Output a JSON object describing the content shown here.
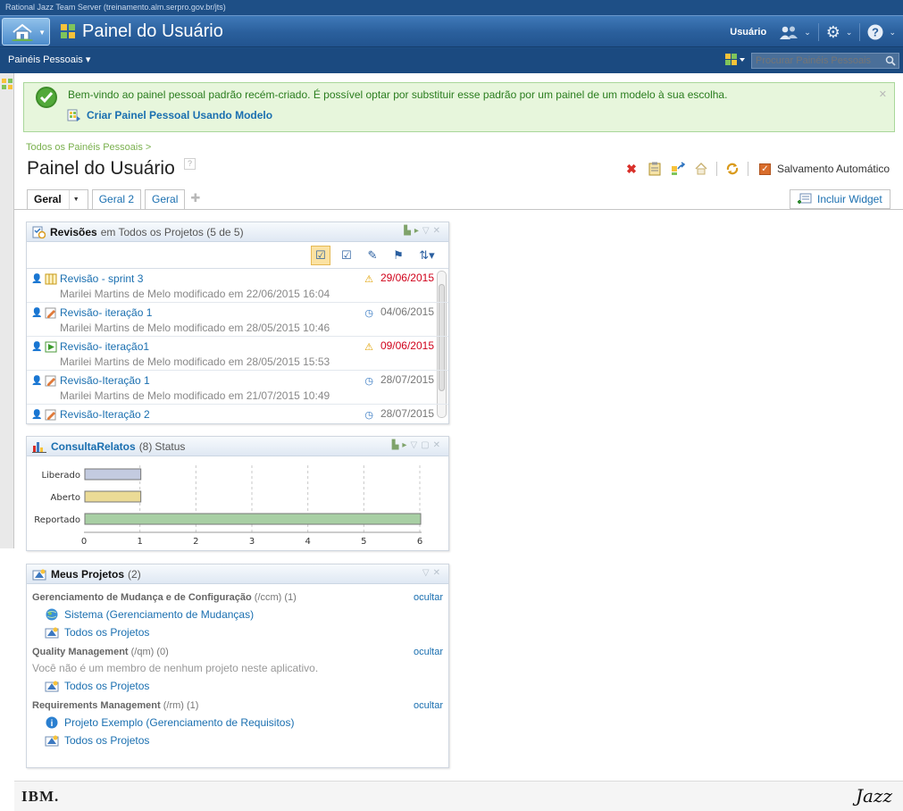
{
  "top": {
    "url": "Rational Jazz Team Server (treinamento.alm.serpro.gov.br/jts)",
    "title": "Painel do Usuário",
    "user_label": "Usuário"
  },
  "subbar": {
    "menu_label": "Painéis Pessoais ▾",
    "search_placeholder": "Procurar Painéis Pessoais"
  },
  "welcome": {
    "message": "Bem-vindo ao painel pessoal padrão recém-criado. É possível optar por substituir esse padrão por um painel de um modelo à sua escolha.",
    "link": "Criar Painel Pessoal Usando Modelo"
  },
  "breadcrumb": "Todos os Painéis Pessoais >",
  "page_title": "Painel do Usuário",
  "help_icon": "?",
  "toolbar": {
    "autosave_label": "Salvamento Automático"
  },
  "tabs": [
    {
      "label": "Geral"
    },
    {
      "label": "Geral 2"
    },
    {
      "label": "Geral"
    }
  ],
  "add_widget_label": "Incluir Widget",
  "reviews": {
    "title": "Revisões",
    "subtitle": "em Todos os Projetos (5 de 5)",
    "items": [
      {
        "name": "Revisão - sprint 3",
        "meta": "Marilei Martins de Melo modificado em 22/06/2015 16:04",
        "date": "29/06/2015",
        "late": true,
        "type": "review-icon"
      },
      {
        "name": "Revisão- iteração 1",
        "meta": "Marilei Martins de Melo modificado em 28/05/2015 10:46",
        "date": "04/06/2015",
        "late": false,
        "type": "edit-icon"
      },
      {
        "name": "Revisão- iteração1",
        "meta": "Marilei Martins de Melo modificado em 28/05/2015 15:53",
        "date": "09/06/2015",
        "late": true,
        "type": "play-icon"
      },
      {
        "name": "Revisão-Iteração 1",
        "meta": "Marilei Martins de Melo modificado em 21/07/2015 10:49",
        "date": "28/07/2015",
        "late": false,
        "type": "edit-icon"
      },
      {
        "name": "Revisão-Iteração 2",
        "meta": "",
        "date": "28/07/2015",
        "late": false,
        "type": "edit-icon"
      }
    ]
  },
  "consulta": {
    "title": "ConsultaRelatos",
    "count": "(8)",
    "subtitle": "Status"
  },
  "chart_data": {
    "type": "bar",
    "orientation": "horizontal",
    "categories": [
      "Liberado",
      "Aberto",
      "Reportado"
    ],
    "values": [
      1,
      1,
      6
    ],
    "colors": [
      "#c3cbe0",
      "#ebdb96",
      "#a8cfa4"
    ],
    "xlim": [
      0,
      6
    ],
    "xticks": [
      "0",
      "1",
      "2",
      "3",
      "4",
      "5",
      "6"
    ],
    "grid": true
  },
  "projects": {
    "title": "Meus Projetos",
    "count": "(2)",
    "hide_label": "ocultar",
    "sections": [
      {
        "name": "Gerenciamento de Mudança e de Configuração",
        "path": "(/ccm)",
        "count": "(1)",
        "links": [
          {
            "label": "Sistema (Gerenciamento de Mudanças)",
            "icon": "globe-icon"
          },
          {
            "label": "Todos os Projetos",
            "icon": "projects-icon"
          }
        ]
      },
      {
        "name": "Quality Management",
        "path": "(/qm)",
        "count": "(0)",
        "empty": "Você não é um membro de nenhum projeto neste aplicativo.",
        "links": [
          {
            "label": "Todos os Projetos",
            "icon": "projects-icon"
          }
        ]
      },
      {
        "name": "Requirements Management",
        "path": "(/rm)",
        "count": "(1)",
        "links": [
          {
            "label": "Projeto Exemplo (Gerenciamento de Requisitos)",
            "icon": "info-globe-icon"
          },
          {
            "label": "Todos os Projetos",
            "icon": "projects-icon"
          }
        ]
      }
    ]
  },
  "footer": {
    "ibm": "IBM.",
    "jazz": "Jazz"
  }
}
